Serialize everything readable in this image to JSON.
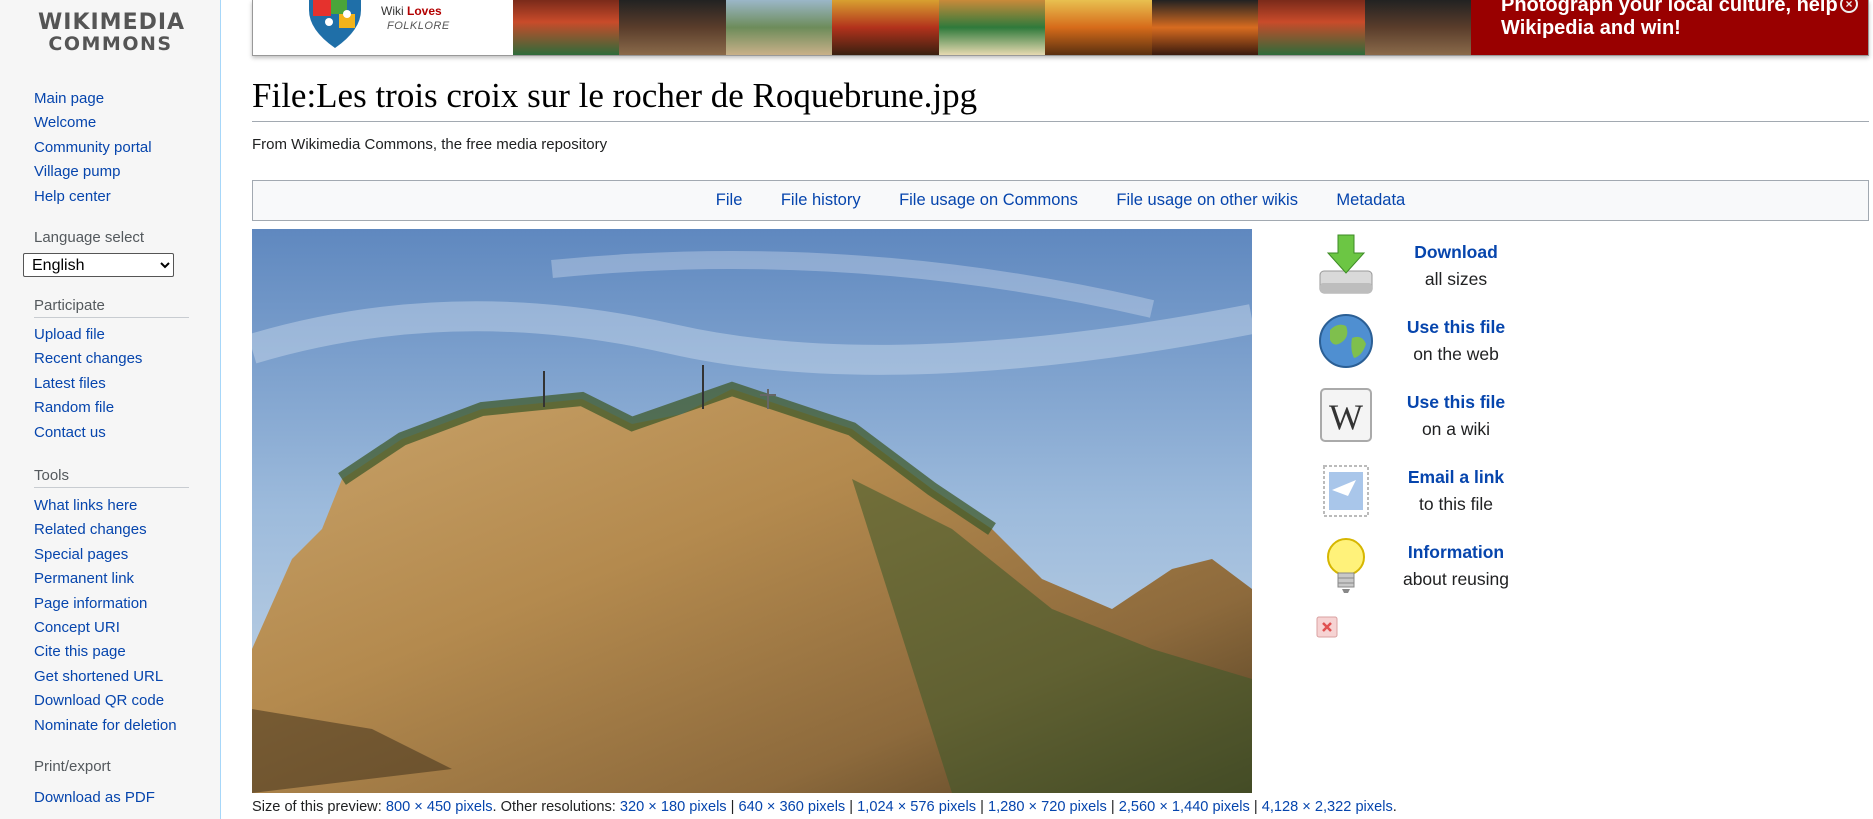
{
  "logo": {
    "line1": "WIKIMEDIA",
    "line2": "COMMONS"
  },
  "sidebar": {
    "nav": [
      "Main page",
      "Welcome",
      "Community portal",
      "Village pump",
      "Help center"
    ],
    "language_label": "Language select",
    "language_value": "English",
    "participate_heading": "Participate",
    "participate": [
      "Upload file",
      "Recent changes",
      "Latest files",
      "Random file",
      "Contact us"
    ],
    "tools_heading": "Tools",
    "tools": [
      "What links here",
      "Related changes",
      "Special pages",
      "Permanent link",
      "Page information",
      "Concept URI",
      "Cite this page",
      "Get shortened URL",
      "Download QR code",
      "Nominate for deletion"
    ],
    "print_heading": "Print/export",
    "print": [
      "Download as PDF"
    ]
  },
  "banner": {
    "logo_line1": "Wiki",
    "logo_line1_bold": "Loves",
    "logo_line2": "FOLKLORE",
    "cta": "Photograph your local culture, help Wikipedia and win!",
    "close_icon": "close-circle-icon"
  },
  "page": {
    "title": "File:Les trois croix sur le rocher de Roquebrune.jpg",
    "tagline": "From Wikimedia Commons, the free media repository"
  },
  "tabs": [
    "File",
    "File history",
    "File usage on Commons",
    "File usage on other wikis",
    "Metadata"
  ],
  "resolutions": {
    "size_label": "Size of this preview:",
    "preview_size": "800 × 450 pixels",
    "other_label": ". Other resolutions:",
    "others": [
      "320 × 180 pixels",
      "640 × 360 pixels",
      "1,024 × 576 pixels",
      "1,280 × 720 pixels",
      "2,560 × 1,440 pixels",
      "4,128 × 2,322 pixels"
    ],
    "end": "."
  },
  "reuse": [
    {
      "link": "Download",
      "sub": "all sizes",
      "icon": "download-drive-icon"
    },
    {
      "link": "Use this file",
      "sub": "on the web",
      "icon": "globe-icon"
    },
    {
      "link": "Use this file",
      "sub": "on a wiki",
      "icon": "wikipedia-w-icon"
    },
    {
      "link": "Email a link",
      "sub": "to this file",
      "icon": "email-stamp-icon"
    },
    {
      "link": "Information",
      "sub": "about reusing",
      "icon": "lightbulb-icon"
    }
  ],
  "colors": {
    "link": "#0645ad",
    "banner_red": "#990000",
    "sidebar_bg": "#f6f6f6"
  }
}
